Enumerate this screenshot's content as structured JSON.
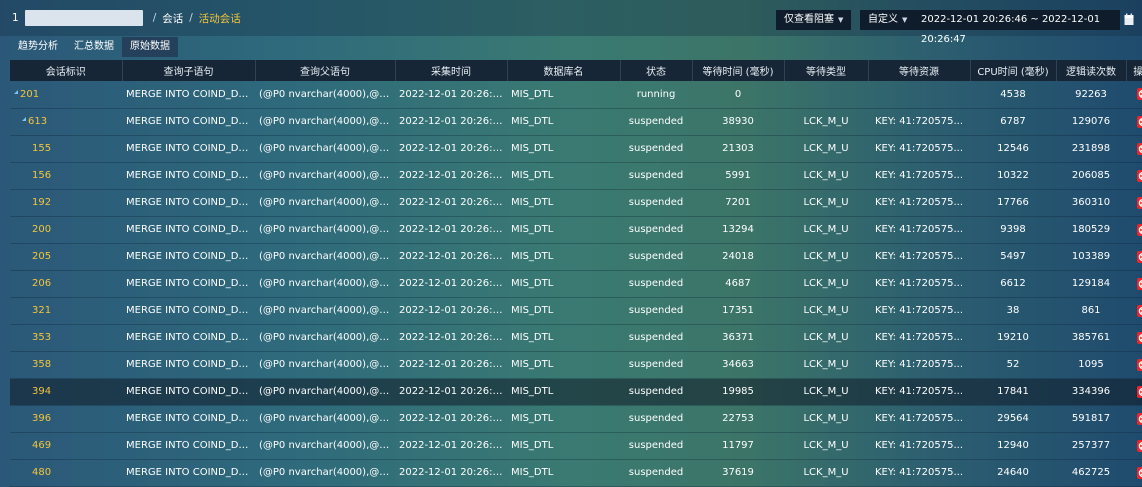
{
  "breadcrumb": {
    "first": "1",
    "sep1": "/",
    "item": "会话",
    "sep2": "/",
    "current": "活动会话"
  },
  "toolbar": {
    "blocked_only_label": "仅查看阻塞",
    "custom_label": "自定义",
    "time_range": "2022-12-01 20:26:46 ~ 2022-12-01 20:26:47"
  },
  "tabs": [
    {
      "label": "趋势分析",
      "active": false
    },
    {
      "label": "汇总数据",
      "active": false
    },
    {
      "label": "原始数据",
      "active": true
    }
  ],
  "table": {
    "headers": [
      "会话标识",
      "查询子语句",
      "查询父语句",
      "采集时间",
      "数据库名",
      "状态",
      "等待时间 (毫秒)",
      "等待类型",
      "等待资源",
      "CPU时间 (毫秒)",
      "逻辑读次数",
      "操作"
    ],
    "rows": [
      {
        "id": "201",
        "expand": true,
        "indent": 0,
        "sub": "MERGE INTO COIND_DS_...",
        "parent": "(@P0 nvarchar(4000),@P...",
        "time": "2022-12-01 20:26:46",
        "db": "MIS_DTL",
        "status": "running",
        "wait": "0",
        "wtype": "",
        "wres": "",
        "cpu": "4538",
        "reads": "92263"
      },
      {
        "id": "613",
        "expand": true,
        "indent": 1,
        "sub": "MERGE INTO COIND_DS_...",
        "parent": "(@P0 nvarchar(4000),@P...",
        "time": "2022-12-01 20:26:46",
        "db": "MIS_DTL",
        "status": "suspended",
        "wait": "38930",
        "wtype": "LCK_M_U",
        "wres": "KEY: 41:720575...",
        "cpu": "6787",
        "reads": "129076"
      },
      {
        "id": "155",
        "expand": false,
        "indent": 2,
        "sub": "MERGE INTO COIND_DS_...",
        "parent": "(@P0 nvarchar(4000),@P...",
        "time": "2022-12-01 20:26:46",
        "db": "MIS_DTL",
        "status": "suspended",
        "wait": "21303",
        "wtype": "LCK_M_U",
        "wres": "KEY: 41:720575...",
        "cpu": "12546",
        "reads": "231898"
      },
      {
        "id": "156",
        "expand": false,
        "indent": 2,
        "sub": "MERGE INTO COIND_DS_...",
        "parent": "(@P0 nvarchar(4000),@P...",
        "time": "2022-12-01 20:26:46",
        "db": "MIS_DTL",
        "status": "suspended",
        "wait": "5991",
        "wtype": "LCK_M_U",
        "wres": "KEY: 41:720575...",
        "cpu": "10322",
        "reads": "206085"
      },
      {
        "id": "192",
        "expand": false,
        "indent": 2,
        "sub": "MERGE INTO COIND_DS_...",
        "parent": "(@P0 nvarchar(4000),@P...",
        "time": "2022-12-01 20:26:46",
        "db": "MIS_DTL",
        "status": "suspended",
        "wait": "7201",
        "wtype": "LCK_M_U",
        "wres": "KEY: 41:720575...",
        "cpu": "17766",
        "reads": "360310"
      },
      {
        "id": "200",
        "expand": false,
        "indent": 2,
        "sub": "MERGE INTO COIND_DS_...",
        "parent": "(@P0 nvarchar(4000),@P...",
        "time": "2022-12-01 20:26:46",
        "db": "MIS_DTL",
        "status": "suspended",
        "wait": "13294",
        "wtype": "LCK_M_U",
        "wres": "KEY: 41:720575...",
        "cpu": "9398",
        "reads": "180529"
      },
      {
        "id": "205",
        "expand": false,
        "indent": 2,
        "sub": "MERGE INTO COIND_DS_...",
        "parent": "(@P0 nvarchar(4000),@P...",
        "time": "2022-12-01 20:26:46",
        "db": "MIS_DTL",
        "status": "suspended",
        "wait": "24018",
        "wtype": "LCK_M_U",
        "wres": "KEY: 41:720575...",
        "cpu": "5497",
        "reads": "103389"
      },
      {
        "id": "206",
        "expand": false,
        "indent": 2,
        "sub": "MERGE INTO COIND_DS_...",
        "parent": "(@P0 nvarchar(4000),@P...",
        "time": "2022-12-01 20:26:46",
        "db": "MIS_DTL",
        "status": "suspended",
        "wait": "4687",
        "wtype": "LCK_M_U",
        "wres": "KEY: 41:720575...",
        "cpu": "6612",
        "reads": "129184"
      },
      {
        "id": "321",
        "expand": false,
        "indent": 2,
        "sub": "MERGE INTO COIND_DS_...",
        "parent": "(@P0 nvarchar(4000),@P...",
        "time": "2022-12-01 20:26:46",
        "db": "MIS_DTL",
        "status": "suspended",
        "wait": "17351",
        "wtype": "LCK_M_U",
        "wres": "KEY: 41:720575...",
        "cpu": "38",
        "reads": "861"
      },
      {
        "id": "353",
        "expand": false,
        "indent": 2,
        "sub": "MERGE INTO COIND_DS_...",
        "parent": "(@P0 nvarchar(4000),@P...",
        "time": "2022-12-01 20:26:46",
        "db": "MIS_DTL",
        "status": "suspended",
        "wait": "36371",
        "wtype": "LCK_M_U",
        "wres": "KEY: 41:720575...",
        "cpu": "19210",
        "reads": "385761"
      },
      {
        "id": "358",
        "expand": false,
        "indent": 2,
        "sub": "MERGE INTO COIND_DS_...",
        "parent": "(@P0 nvarchar(4000),@P...",
        "time": "2022-12-01 20:26:46",
        "db": "MIS_DTL",
        "status": "suspended",
        "wait": "34663",
        "wtype": "LCK_M_U",
        "wres": "KEY: 41:720575...",
        "cpu": "52",
        "reads": "1095"
      },
      {
        "id": "394",
        "expand": false,
        "indent": 2,
        "highlight": true,
        "sub": "MERGE INTO COIND_DS_...",
        "parent": "(@P0 nvarchar(4000),@P...",
        "time": "2022-12-01 20:26:46",
        "db": "MIS_DTL",
        "status": "suspended",
        "wait": "19985",
        "wtype": "LCK_M_U",
        "wres": "KEY: 41:720575...",
        "cpu": "17841",
        "reads": "334396"
      },
      {
        "id": "396",
        "expand": false,
        "indent": 2,
        "sub": "MERGE INTO COIND_DS_...",
        "parent": "(@P0 nvarchar(4000),@P...",
        "time": "2022-12-01 20:26:46",
        "db": "MIS_DTL",
        "status": "suspended",
        "wait": "22753",
        "wtype": "LCK_M_U",
        "wres": "KEY: 41:720575...",
        "cpu": "29564",
        "reads": "591817"
      },
      {
        "id": "469",
        "expand": false,
        "indent": 2,
        "sub": "MERGE INTO COIND_DS_...",
        "parent": "(@P0 nvarchar(4000),@P...",
        "time": "2022-12-01 20:26:46",
        "db": "MIS_DTL",
        "status": "suspended",
        "wait": "11797",
        "wtype": "LCK_M_U",
        "wres": "KEY: 41:720575...",
        "cpu": "12940",
        "reads": "257377"
      },
      {
        "id": "480",
        "expand": false,
        "indent": 2,
        "sub": "MERGE INTO COIND_DS_...",
        "parent": "(@P0 nvarchar(4000),@P...",
        "time": "2022-12-01 20:26:46",
        "db": "MIS_DTL",
        "status": "suspended",
        "wait": "37619",
        "wtype": "LCK_M_U",
        "wres": "KEY: 41:720575...",
        "cpu": "24640",
        "reads": "462725"
      }
    ]
  },
  "icons": {
    "expand": "expand-triangle-icon",
    "action": "kill-session-icon",
    "date": "calendar-icon",
    "dropdown": "caret-down-icon"
  },
  "colors": {
    "session_id": "#f3c53b",
    "action": "#e8262c",
    "breadcrumb_current": "#f3c53b"
  }
}
